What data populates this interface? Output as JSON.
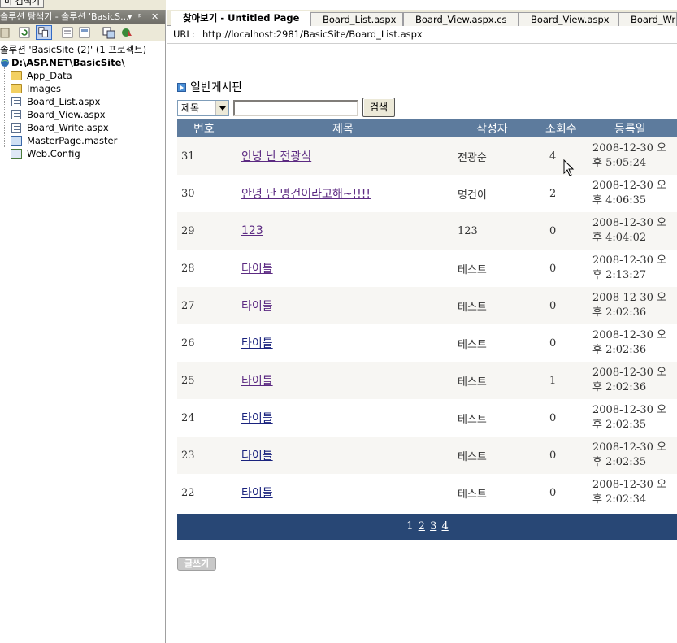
{
  "top_fragment": "미 검색기",
  "solution_explorer": {
    "title": "솔루션 탐색기 - 솔루션 'BasicS...",
    "title_controls": [
      "▾",
      "ᵖ",
      "✕"
    ],
    "solution_label": "솔루션 'BasicSite (2)' (1 프로젝트)",
    "project_label": "D:\\ASP.NET\\BasicSite\\",
    "items": [
      {
        "label": "App_Data",
        "icon": "folder-icon"
      },
      {
        "label": "Images",
        "icon": "folder-icon"
      },
      {
        "label": "Board_List.aspx",
        "icon": "aspx-file-icon"
      },
      {
        "label": "Board_View.aspx",
        "icon": "aspx-file-icon"
      },
      {
        "label": "Board_Write.aspx",
        "icon": "aspx-file-icon"
      },
      {
        "label": "MasterPage.master",
        "icon": "master-file-icon"
      },
      {
        "label": "Web.Config",
        "icon": "config-file-icon"
      }
    ]
  },
  "editor": {
    "tabs": [
      {
        "label": "찾아보기 - Untitled Page",
        "active": true
      },
      {
        "label": "Board_List.aspx",
        "active": false
      },
      {
        "label": "Board_View.aspx.cs",
        "active": false
      },
      {
        "label": "Board_View.aspx",
        "active": false
      },
      {
        "label": "Board_Wri",
        "active": false
      }
    ],
    "url_label": "URL:",
    "url_value": "http://localhost:2981/BasicSite/Board_List.aspx"
  },
  "board": {
    "title": "일반게시판",
    "search_field_selected": "제목",
    "search_text": "",
    "search_button": "검색",
    "columns": [
      "번호",
      "제목",
      "작성자",
      "조회수",
      "등록일"
    ],
    "rows": [
      {
        "no": "31",
        "title": "안녕 난 전광식",
        "author": "전광순",
        "views": "4",
        "date1": "2008-12-30 오",
        "date2": "후 5:05:24"
      },
      {
        "no": "30",
        "title": "안녕 난 명건이라고해~!!!!",
        "author": "명건이",
        "views": "2",
        "date1": "2008-12-30 오",
        "date2": "후 4:06:35"
      },
      {
        "no": "29",
        "title": "123",
        "author": "123",
        "views": "0",
        "date1": "2008-12-30 오",
        "date2": "후 4:04:02"
      },
      {
        "no": "28",
        "title": "타이틀",
        "author": "테스트",
        "views": "0",
        "date1": "2008-12-30 오",
        "date2": "후 2:13:27"
      },
      {
        "no": "27",
        "title": "타이틀",
        "author": "테스트",
        "views": "0",
        "date1": "2008-12-30 오",
        "date2": "후 2:02:36"
      },
      {
        "no": "26",
        "title": "타이틀",
        "author": "테스트",
        "views": "0",
        "date1": "2008-12-30 오",
        "date2": "후 2:02:36"
      },
      {
        "no": "25",
        "title": "타이틀",
        "author": "테스트",
        "views": "1",
        "date1": "2008-12-30 오",
        "date2": "후 2:02:36"
      },
      {
        "no": "24",
        "title": "타이틀",
        "author": "테스트",
        "views": "0",
        "date1": "2008-12-30 오",
        "date2": "후 2:02:35"
      },
      {
        "no": "23",
        "title": "타이틀",
        "author": "테스트",
        "views": "0",
        "date1": "2008-12-30 오",
        "date2": "후 2:02:35"
      },
      {
        "no": "22",
        "title": "타이틀",
        "author": "테스트",
        "views": "0",
        "date1": "2008-12-30 오",
        "date2": "후 2:02:34"
      }
    ],
    "pager": [
      "1",
      "2",
      "3",
      "4"
    ],
    "write_button": "글쓰기"
  },
  "colors": {
    "header_bg": "#5d7b9d",
    "pager_bg": "#284775",
    "row_alt_bg": "#f7f6f3",
    "link_visited": "#5c2a82",
    "link_unvisited": "#1a237e"
  }
}
